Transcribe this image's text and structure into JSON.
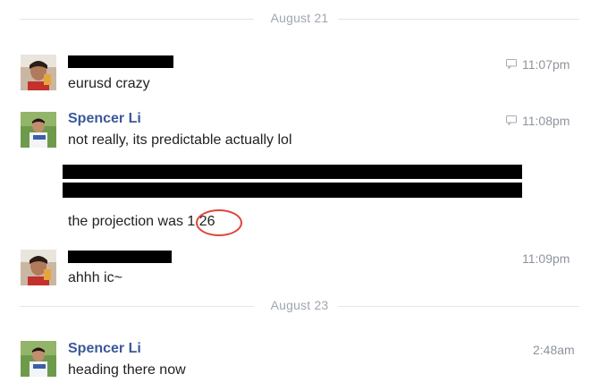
{
  "dates": {
    "first": "August 21",
    "second": "August 23"
  },
  "messages": [
    {
      "sender": "",
      "text": "eurusd crazy",
      "time": "11:07pm",
      "icon": "chat-bubble-icon"
    },
    {
      "sender": "Spencer Li",
      "text": "not really, its predictable actually lol",
      "time": "11:08pm",
      "icon": "chat-bubble-icon"
    },
    {
      "sender": "Spencer Li",
      "text_prefix": "the projection was ",
      "text_highlight": "1.26"
    },
    {
      "sender": "",
      "text": "ahhh ic~",
      "time": "11:09pm"
    },
    {
      "sender": "Spencer Li",
      "text": "heading there now",
      "time": "2:48am"
    }
  ],
  "colors": {
    "sender_name": "#3b5998",
    "highlight_circle": "#e0453b",
    "date_divider": "#a0a6b0"
  }
}
